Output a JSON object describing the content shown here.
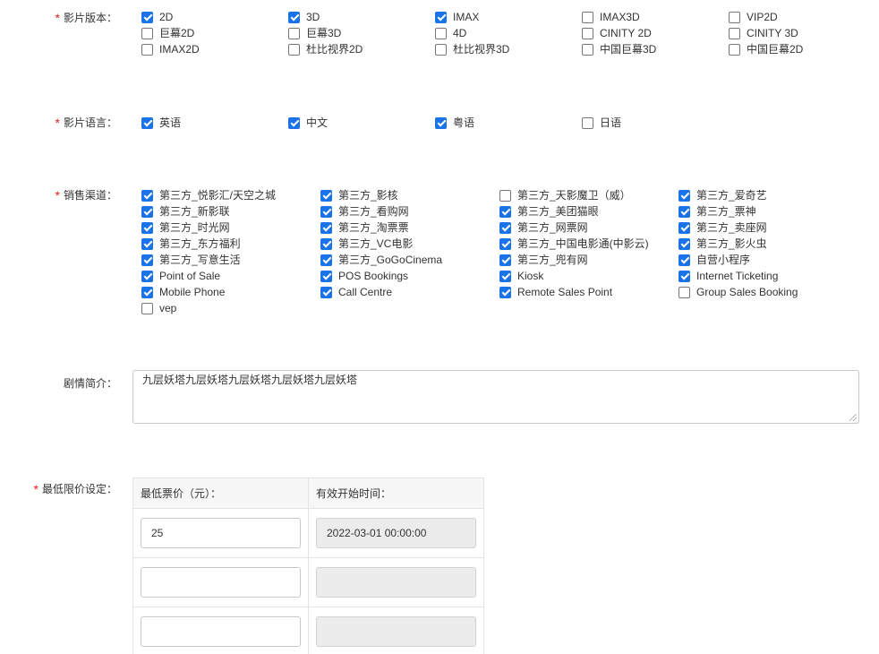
{
  "film_version": {
    "label": "影片版本：",
    "options": [
      {
        "label": "2D",
        "checked": true
      },
      {
        "label": "3D",
        "checked": true
      },
      {
        "label": "IMAX",
        "checked": true
      },
      {
        "label": "IMAX3D",
        "checked": false
      },
      {
        "label": "VIP2D",
        "checked": false
      },
      {
        "label": "巨幕2D",
        "checked": false
      },
      {
        "label": "巨幕3D",
        "checked": false
      },
      {
        "label": "4D",
        "checked": false
      },
      {
        "label": "CINITY 2D",
        "checked": false
      },
      {
        "label": "CINITY 3D",
        "checked": false
      },
      {
        "label": "IMAX2D",
        "checked": false
      },
      {
        "label": "杜比视界2D",
        "checked": false
      },
      {
        "label": "杜比视界3D",
        "checked": false
      },
      {
        "label": "中国巨幕3D",
        "checked": false
      },
      {
        "label": "中国巨幕2D",
        "checked": false
      }
    ]
  },
  "film_language": {
    "label": "影片语言：",
    "options": [
      {
        "label": "英语",
        "checked": true
      },
      {
        "label": "中文",
        "checked": true
      },
      {
        "label": "粤语",
        "checked": true
      },
      {
        "label": "日语",
        "checked": false
      }
    ]
  },
  "sales_channel": {
    "label": "销售渠道：",
    "options": [
      {
        "label": "第三方_悦影汇/天空之城",
        "checked": true
      },
      {
        "label": "第三方_影核",
        "checked": true
      },
      {
        "label": "第三方_天影魔卫（威）",
        "checked": false
      },
      {
        "label": "第三方_爱奇艺",
        "checked": true
      },
      {
        "label": "第三方_新影联",
        "checked": true
      },
      {
        "label": "第三方_看购网",
        "checked": true
      },
      {
        "label": "第三方_美团猫眼",
        "checked": true
      },
      {
        "label": "第三方_票神",
        "checked": true
      },
      {
        "label": "第三方_时光网",
        "checked": true
      },
      {
        "label": "第三方_淘票票",
        "checked": true
      },
      {
        "label": "第三方_网票网",
        "checked": true
      },
      {
        "label": "第三方_卖座网",
        "checked": true
      },
      {
        "label": "第三方_东方福利",
        "checked": true
      },
      {
        "label": "第三方_VC电影",
        "checked": true
      },
      {
        "label": "第三方_中国电影通(中影云)",
        "checked": true
      },
      {
        "label": "第三方_影火虫",
        "checked": true
      },
      {
        "label": "第三方_写意生活",
        "checked": true
      },
      {
        "label": "第三方_GoGoCinema",
        "checked": true
      },
      {
        "label": "第三方_兜有网",
        "checked": true
      },
      {
        "label": "自营小程序",
        "checked": true
      },
      {
        "label": "Point of Sale",
        "checked": true
      },
      {
        "label": "POS Bookings",
        "checked": true
      },
      {
        "label": "Kiosk",
        "checked": true
      },
      {
        "label": "Internet Ticketing",
        "checked": true
      },
      {
        "label": "Mobile Phone",
        "checked": true
      },
      {
        "label": "Call Centre",
        "checked": true
      },
      {
        "label": "Remote Sales Point",
        "checked": true
      },
      {
        "label": "Group Sales Booking",
        "checked": false
      },
      {
        "label": "vep",
        "checked": false
      }
    ]
  },
  "synopsis": {
    "label": "剧情简介：",
    "value": "九层妖塔九层妖塔九层妖塔九层妖塔九层妖塔"
  },
  "min_price": {
    "label": "最低限价设定：",
    "col_price": "最低票价（元）：",
    "col_start": "有效开始时间：",
    "rows": [
      {
        "price": "25",
        "start": "2022-03-01 00:00:00"
      },
      {
        "price": "",
        "start": ""
      },
      {
        "price": "",
        "start": ""
      }
    ]
  },
  "colors": {
    "required": "#e02020",
    "checkbox_checked": "#1a73e8"
  }
}
